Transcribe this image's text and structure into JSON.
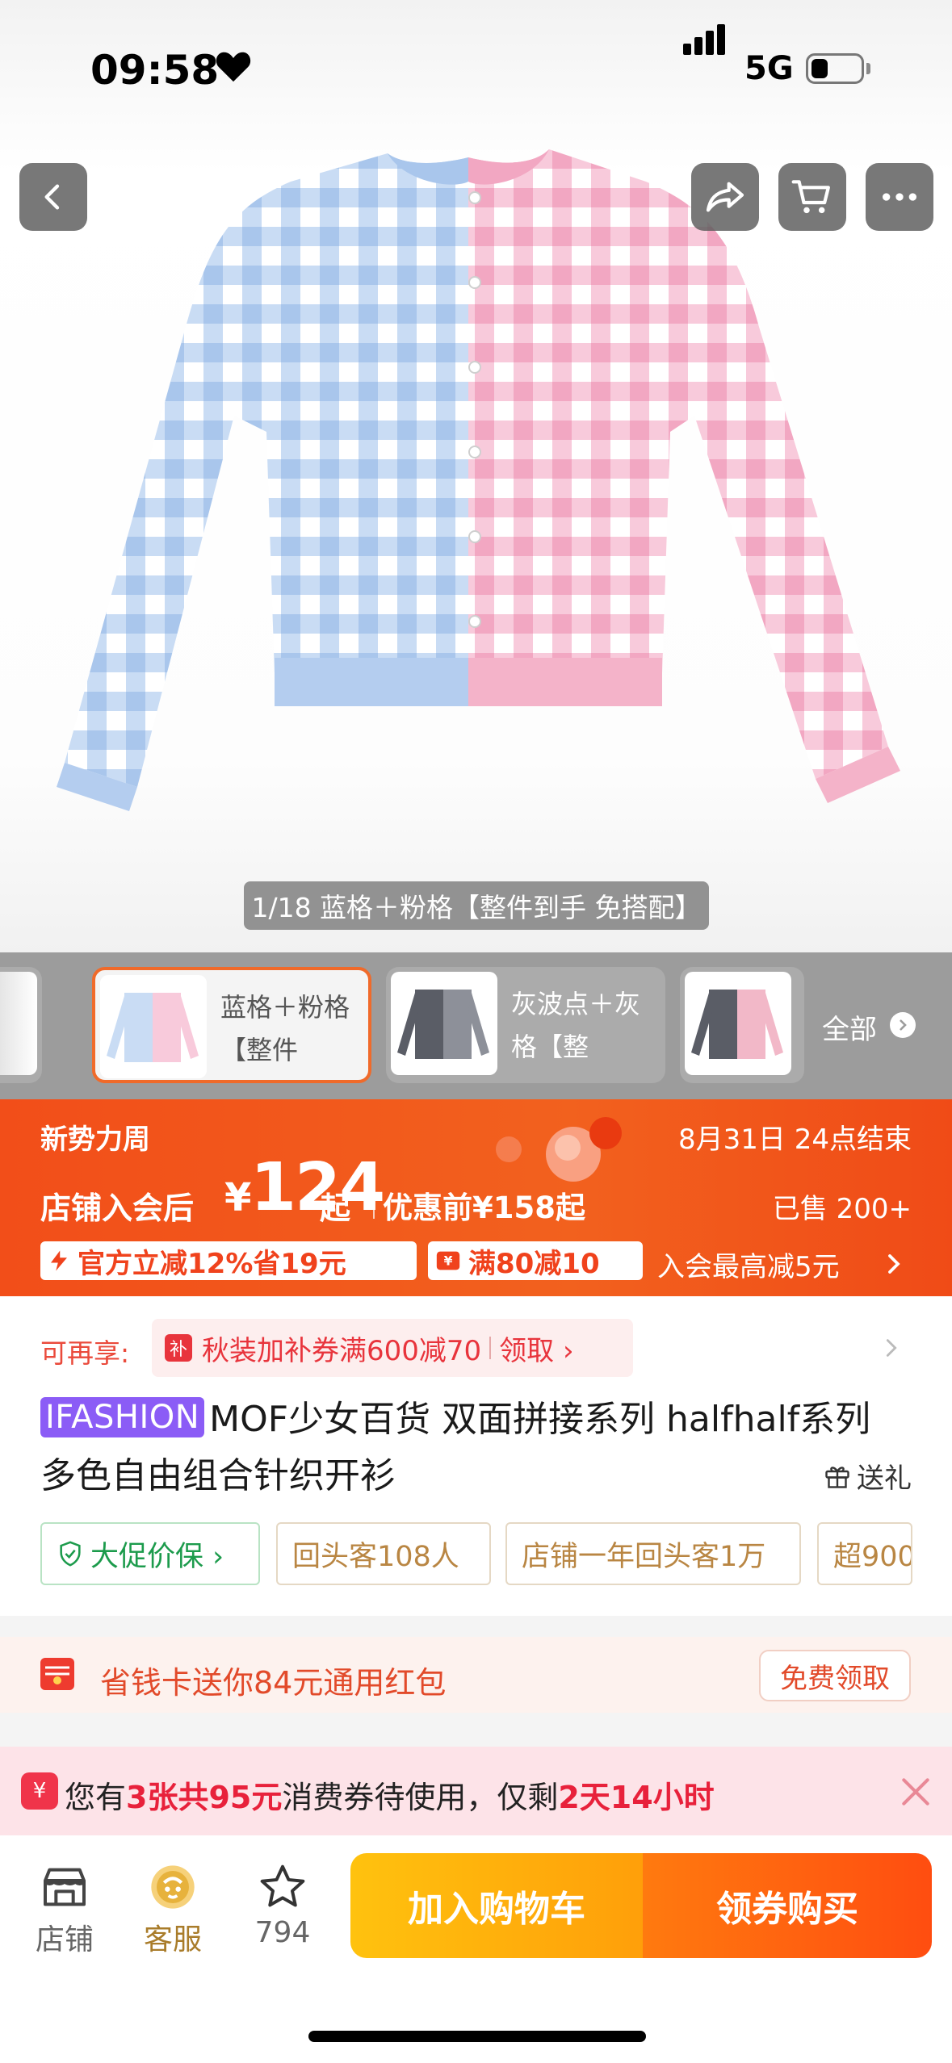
{
  "status_bar": {
    "time": "09:58",
    "network": "5G",
    "battery_level": 0.35
  },
  "header": {
    "back_icon": "chevron-left-icon",
    "share_icon": "share-icon",
    "cart_icon": "cart-icon",
    "more_icon": "more-icon"
  },
  "gallery": {
    "caption": "1/18 蓝格＋粉格【整件到手 免搭配】"
  },
  "variants": {
    "items": [
      {
        "label": "蓝格＋粉格【整件"
      },
      {
        "label": "灰波点＋灰格【整"
      }
    ],
    "all_label": "全部"
  },
  "promo": {
    "event_name": "新势力周",
    "event_end": "8月31日 24点结束",
    "member_price_label": "店铺入会后",
    "currency": "¥",
    "member_price": "124",
    "price_suffix": "起",
    "original_price": "优惠前¥158起",
    "sold": "已售 200+",
    "discount_chip": "官方立减12%省19元",
    "full_reduction_chip": "满80减10",
    "member_max": "入会最高减5元"
  },
  "coupon": {
    "label": "可再享:",
    "badge": "补",
    "text": "秋装加补券满600减70",
    "claim": "领取 ›"
  },
  "product": {
    "brand": "IFASHION",
    "title": "MOF少女百货 双面拼接系列 halfhalf系列 多色自由组合针织开衫",
    "gift": "送礼"
  },
  "tags": {
    "promo": "大促价保 ›",
    "returning": "回头客108人",
    "year": "店铺一年回头客1万",
    "more": "超900"
  },
  "saver": {
    "text": "省钱卡送你84元通用红包",
    "claim": "免费领取"
  },
  "voucher": {
    "icon": "¥",
    "prefix": "您有",
    "count": "3张共95元",
    "middle": "消费券待使用，仅剩",
    "remaining": "2天14小时"
  },
  "bottom_bar": {
    "shop": "店铺",
    "service": "客服",
    "favorites": "794",
    "add_to_cart": "加入购物车",
    "buy": "领券购买"
  },
  "colors": {
    "accent": "#f24e19",
    "brand_tag": "#8b5cf6",
    "gingham_blue": "#b9d3f2",
    "gingham_pink": "#f6b7cb"
  }
}
